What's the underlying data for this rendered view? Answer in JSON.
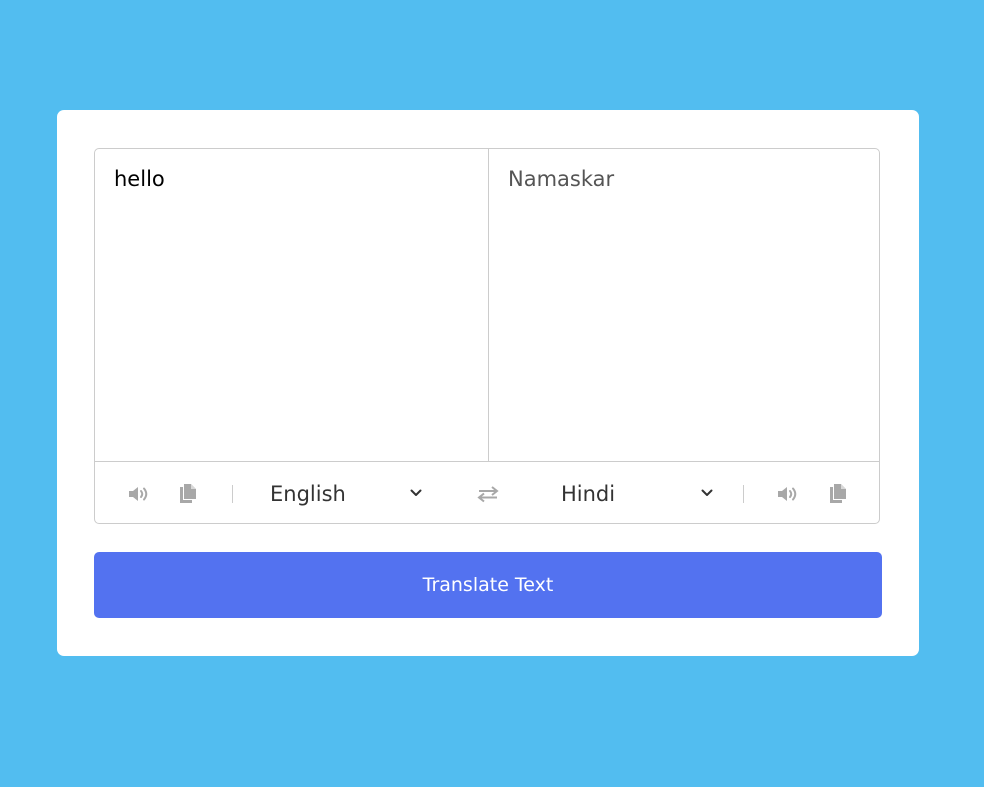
{
  "from": {
    "text": "hello",
    "language": "English"
  },
  "to": {
    "text": "Namaskar",
    "language": "Hindi"
  },
  "icons": {
    "speak": "volume-up-icon",
    "copy": "copy-icon",
    "swap": "exchange-icon",
    "dropdown": "chevron-down-icon"
  },
  "translate_button": {
    "label": "Translate Text"
  },
  "colors": {
    "background": "#52bdf0",
    "card": "#ffffff",
    "button": "#5372f0",
    "icon": "#a8a8a8",
    "border": "#cccccc"
  }
}
